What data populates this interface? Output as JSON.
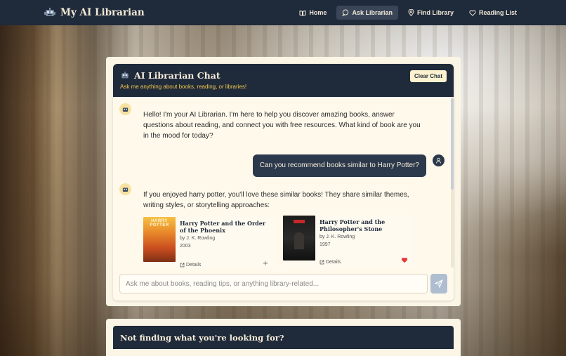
{
  "nav": {
    "brand": "My AI Librarian",
    "links": [
      {
        "label": "Home",
        "icon": "book-open-icon"
      },
      {
        "label": "Ask Librarian",
        "icon": "chat-bubble-icon"
      },
      {
        "label": "Find Library",
        "icon": "map-pin-icon"
      },
      {
        "label": "Reading List",
        "icon": "heart-icon"
      }
    ],
    "active": "Ask Librarian"
  },
  "chat": {
    "title": "AI Librarian Chat",
    "subtitle": "Ask me anything about books, reading, or libraries!",
    "clear_label": "Clear Chat",
    "messages": [
      {
        "role": "bot",
        "text": "Hello! I'm your AI Librarian. I'm here to help you discover amazing books, answer questions about reading, and connect you with free resources. What kind of book are you in the mood for today?"
      },
      {
        "role": "user",
        "text": "Can you recommend books similar to Harry Potter?"
      },
      {
        "role": "bot",
        "text": "If you enjoyed harry potter, you'll love these similar books! They share similar themes, writing styles, or storytelling approaches:"
      }
    ],
    "books": [
      {
        "title": "Harry Potter and the Order of the Phoenix",
        "author": "by J. K. Rowling",
        "year": "2003",
        "details_label": "Details",
        "action": "add",
        "cover_text": "HARRY POTTER"
      },
      {
        "title": "Harry Potter and the Philosopher's Stone",
        "author": "by J. K. Rowling",
        "year": "1997",
        "details_label": "Details",
        "action": "favorited"
      }
    ],
    "input_placeholder": "Ask me about books, reading tips, or anything library-related..."
  },
  "help": {
    "title": "Not finding what you're looking for?"
  },
  "colors": {
    "navy": "#1f2a3a",
    "accent_yellow": "#f2c94c",
    "cream": "#fff9ec",
    "heart_red": "#e53935"
  }
}
